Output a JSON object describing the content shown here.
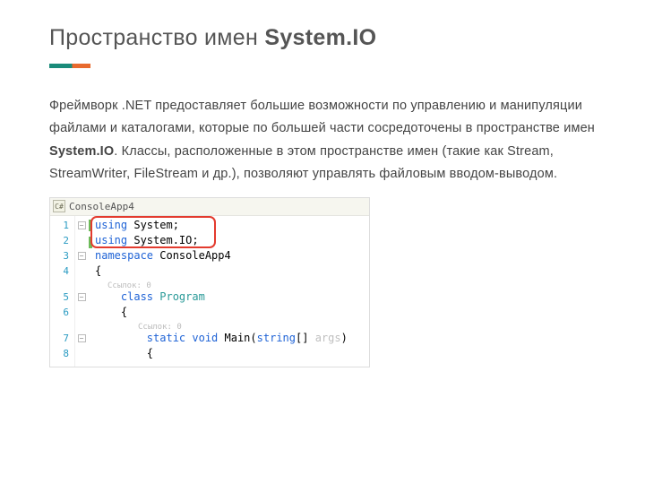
{
  "title_prefix": "Пространство имен ",
  "title_bold": "System.IO",
  "para_1a": "Фреймворк .NET предоставляет большие возможности по управлению и манипуляции файлами и каталогами, которые по большей части сосредоточены в пространстве имен ",
  "para_1b": "System.IO",
  "para_1c": ". Классы, расположенные в этом пространстве имен (такие как Stream, StreamWriter, FileStream и др.), позволяют управлять файловым вводом-выводом.",
  "tab_icon": "C#",
  "tab_label": "ConsoleApp4",
  "refs_label": "Ссылок: 0",
  "code": {
    "l1_kw": "using",
    "l1_rest": " System;",
    "l2_kw": "using",
    "l2_rest": " System.IO;",
    "l3_kw": "namespace",
    "l3_rest": " ConsoleApp4",
    "l4": "{",
    "l5_kw": "class",
    "l5_typ": " Program",
    "l6": "{",
    "l7_kw": "static",
    "l7_kw2": " void",
    "l7_name": " Main(",
    "l7_kw3": "string",
    "l7_rest": "[] ",
    "l7_arg": "args",
    "l7_end": ")",
    "l8": "{"
  },
  "gutter": [
    "1",
    "2",
    "3",
    "4",
    "5",
    "6",
    "7",
    "8"
  ]
}
